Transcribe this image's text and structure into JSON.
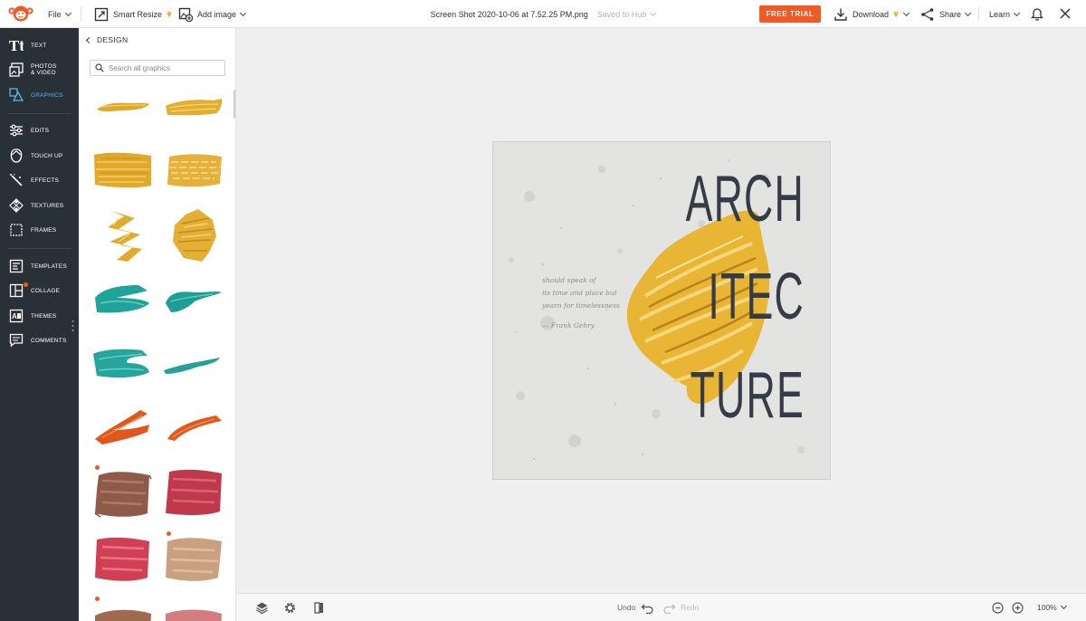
{
  "topbar": {
    "file_label": "File",
    "smart_resize_label": "Smart Resize",
    "add_image_label": "Add image",
    "document_name": "Screen Shot 2020-10-06 at 7.52.25 PM.png",
    "save_status": "Saved to Hub",
    "trial_label": "FREE TRIAL",
    "download_label": "Download",
    "share_label": "Share",
    "learn_label": "Learn",
    "accent_color": "#f15a24"
  },
  "rail": {
    "items": [
      {
        "label": "TEXT",
        "icon": "text-icon"
      },
      {
        "label": "PHOTOS & VIDEO",
        "icon": "photos-icon"
      },
      {
        "label": "GRAPHICS",
        "icon": "graphics-icon",
        "active": true
      },
      {
        "label": "EDITS",
        "icon": "sliders-icon"
      },
      {
        "label": "TOUCH UP",
        "icon": "face-icon"
      },
      {
        "label": "EFFECTS",
        "icon": "magic-wand-icon"
      },
      {
        "label": "TEXTURES",
        "icon": "checker-icon"
      },
      {
        "label": "FRAMES",
        "icon": "frame-icon"
      },
      {
        "label": "TEMPLATES",
        "icon": "template-icon"
      },
      {
        "label": "COLLAGE",
        "icon": "collage-icon"
      },
      {
        "label": "THEMES",
        "icon": "themes-icon"
      },
      {
        "label": "COMMENTS",
        "icon": "comment-icon"
      }
    ],
    "active_color": "#5fb6e6",
    "background": "#283038"
  },
  "panel": {
    "back_label": "DESIGN",
    "search_placeholder": "Search all graphics",
    "swatches": [
      {
        "name": "gold-stroke-thin",
        "color": "#e0a72a"
      },
      {
        "name": "gold-stroke-wide",
        "color": "#e3ad2e"
      },
      {
        "name": "gold-brush-block",
        "color": "#e2a82a"
      },
      {
        "name": "gold-brush-dry",
        "color": "#e6b13a"
      },
      {
        "name": "gold-zigzag",
        "color": "#e2aa2c"
      },
      {
        "name": "gold-scribble",
        "color": "#e4b034"
      },
      {
        "name": "teal-stroke-bold",
        "color": "#1fa39a"
      },
      {
        "name": "teal-stroke-taper",
        "color": "#1f9e96"
      },
      {
        "name": "teal-stroke-wave",
        "color": "#24a69c"
      },
      {
        "name": "teal-stroke-thin",
        "color": "#24a198"
      },
      {
        "name": "orange-stroke-zigzag",
        "color": "#e0561c"
      },
      {
        "name": "orange-stroke-curve",
        "color": "#e05a1e"
      },
      {
        "name": "brown-lipstick-smear",
        "color": "#8f5a48"
      },
      {
        "name": "red-lipstick-smear",
        "color": "#c0394a"
      },
      {
        "name": "pink-lipstick-smear",
        "color": "#cf4055"
      },
      {
        "name": "nude-lipstick-smear",
        "color": "#c9a080"
      },
      {
        "name": "brown-smear-partial",
        "color": "#a06a50"
      },
      {
        "name": "rose-smear-partial",
        "color": "#d27d80"
      }
    ]
  },
  "artwork": {
    "quote_lines": [
      "should speak of",
      "its time and place but",
      "yearn for timelessness"
    ],
    "author": "— Frank Gehry",
    "title_lines": [
      "ARCH",
      "ITEC",
      "TURE"
    ],
    "title_color": "#353c46",
    "brush_color": "#e8b534"
  },
  "bottombar": {
    "undo_label": "Undo",
    "redo_label": "Redo",
    "zoom_level": "100%"
  }
}
